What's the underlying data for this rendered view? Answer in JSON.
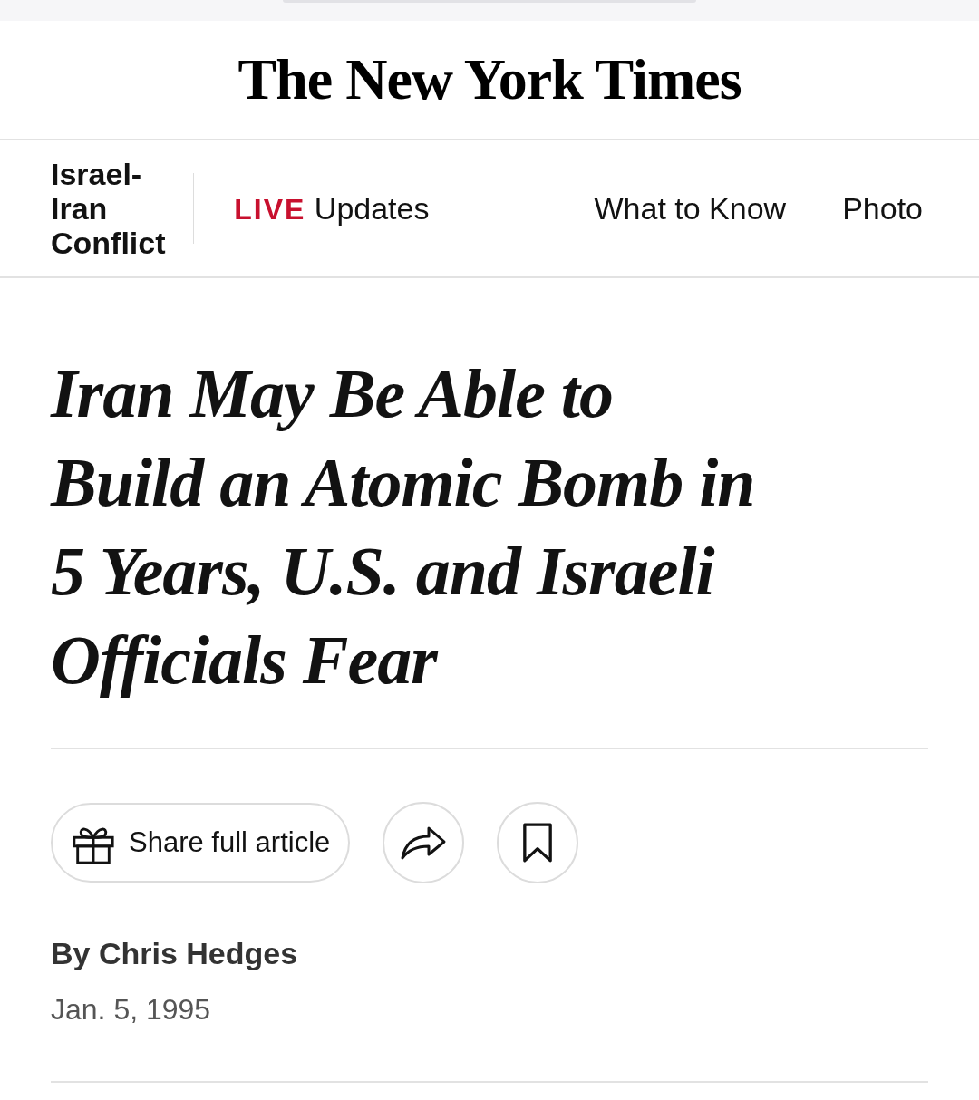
{
  "masthead": {
    "title": "The New York Times"
  },
  "nav": {
    "section": "Israel-Iran Conflict",
    "items": [
      {
        "kind": "live",
        "badge": "LIVE",
        "label": "Updates"
      },
      {
        "kind": "plain",
        "label": "What to Know"
      },
      {
        "kind": "plain",
        "label": "Photo"
      }
    ]
  },
  "article": {
    "headline": "Iran May Be Able to Build an Atomic Bomb in 5 Years, U.S. and Israeli Officials Fear",
    "share_button": "Share full article",
    "byline": "By Chris Hedges",
    "date": "Jan. 5, 1995"
  }
}
